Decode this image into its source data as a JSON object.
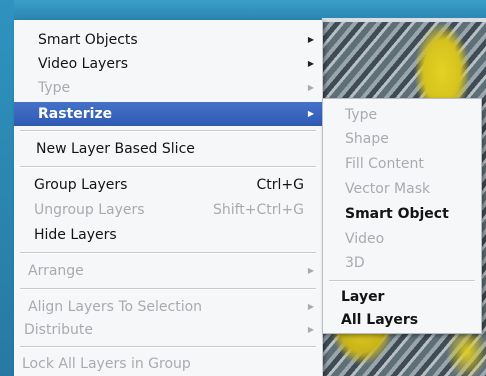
{
  "menu": {
    "items": [
      {
        "label": "Smart Objects",
        "submenu": true,
        "enabled": true
      },
      {
        "label": "Video Layers",
        "submenu": true,
        "enabled": true
      },
      {
        "label": "Type",
        "submenu": true,
        "enabled": false
      },
      {
        "label": "Rasterize",
        "submenu": true,
        "enabled": true,
        "highlighted": true
      },
      {
        "label": "New Layer Based Slice",
        "enabled": true
      },
      {
        "label": "Group Layers",
        "shortcut": "Ctrl+G",
        "enabled": true
      },
      {
        "label": "Ungroup Layers",
        "shortcut": "Shift+Ctrl+G",
        "enabled": false
      },
      {
        "label": "Hide Layers",
        "enabled": true
      },
      {
        "label": "Arrange",
        "submenu": true,
        "enabled": false
      },
      {
        "label": "Align Layers To Selection",
        "submenu": true,
        "enabled": false
      },
      {
        "label": "Distribute",
        "submenu": true,
        "enabled": false
      },
      {
        "label": "Lock All Layers in Group",
        "enabled": false
      }
    ]
  },
  "submenu": {
    "parent": "Rasterize",
    "items": [
      {
        "label": "Type",
        "enabled": false
      },
      {
        "label": "Shape",
        "enabled": false
      },
      {
        "label": "Fill Content",
        "enabled": false
      },
      {
        "label": "Vector Mask",
        "enabled": false
      },
      {
        "label": "Smart Object",
        "enabled": true
      },
      {
        "label": "Video",
        "enabled": false
      },
      {
        "label": "3D",
        "enabled": false
      },
      {
        "label": "Layer",
        "enabled": true
      },
      {
        "label": "All Layers",
        "enabled": true
      }
    ]
  },
  "icons": {
    "submenu_arrow": "triangle-right-icon"
  },
  "colors": {
    "highlight": "#3a66be",
    "menu_bg": "#f6f7f9",
    "disabled_text": "#a7abb0",
    "desktop": "#2d8fb8"
  }
}
